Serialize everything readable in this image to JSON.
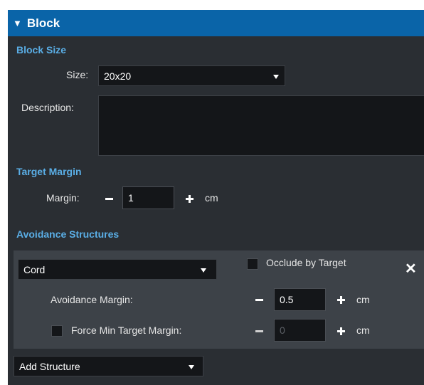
{
  "header": {
    "collapse_icon": "triangle-down-icon",
    "title": "Block"
  },
  "block_size": {
    "section_title": "Block Size",
    "size_label": "Size:",
    "size_value": "20x20",
    "description_label": "Description:",
    "description_value": ""
  },
  "target_margin": {
    "section_title": "Target Margin",
    "margin_label": "Margin:",
    "margin_value": "1",
    "unit": "cm"
  },
  "avoidance": {
    "section_title": "Avoidance Structures",
    "structure": {
      "name": "Cord",
      "occlude_label": "Occlude by Target",
      "occlude_checked": false,
      "remove_icon": "close-icon",
      "avoidance_margin_label": "Avoidance Margin:",
      "avoidance_margin_value": "0.5",
      "avoidance_unit": "cm",
      "force_min_label": "Force Min Target Margin:",
      "force_min_checked": false,
      "force_min_value": "0",
      "force_min_unit": "cm"
    },
    "add_structure_label": "Add Structure"
  },
  "colors": {
    "header_bg": "#0a64a8",
    "panel_bg": "#2a2e33",
    "section_title": "#5aaee6",
    "card_bg": "#3d4248"
  }
}
